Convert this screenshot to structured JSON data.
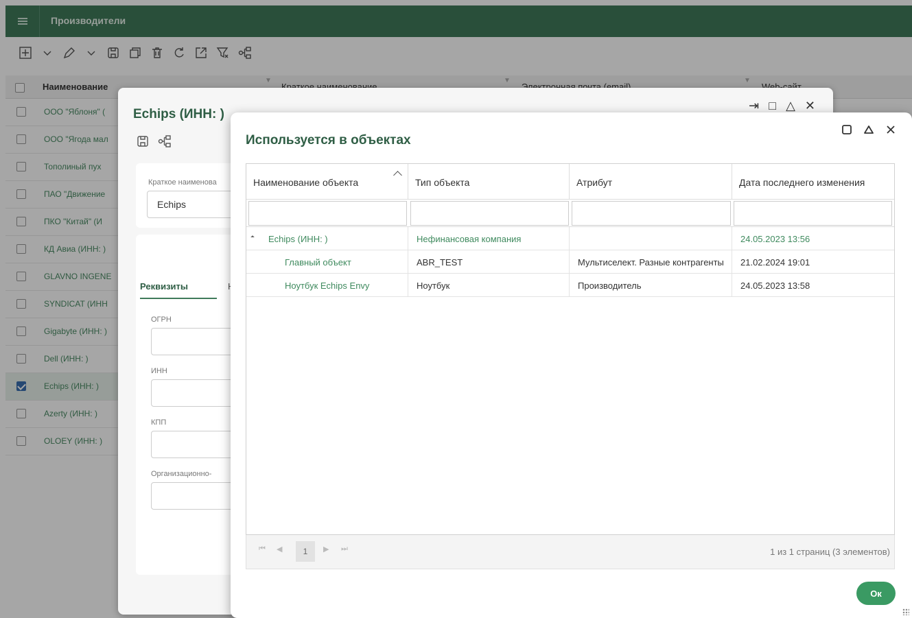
{
  "app": {
    "title": "Производители"
  },
  "grid": {
    "columns": [
      "Наименование",
      "Краткое наименование",
      "Электронная почта (email)",
      "Web-сайт"
    ],
    "rows": [
      {
        "name": "ООО \"Яблоня\" (",
        "checked": false
      },
      {
        "name": "ООО \"Ягода мал",
        "checked": false
      },
      {
        "name": "Тополиный пух",
        "checked": false
      },
      {
        "name": "ПАО \"Движение",
        "checked": false
      },
      {
        "name": "ПКО \"Китай\" (И",
        "checked": false
      },
      {
        "name": "КД Авиа (ИНН: )",
        "checked": false
      },
      {
        "name": "GLAVNO INGENE",
        "checked": false
      },
      {
        "name": "SYNDICAT (ИНН",
        "checked": false
      },
      {
        "name": "Gigabyte (ИНН: )",
        "checked": false
      },
      {
        "name": "Dell (ИНН: )",
        "checked": false
      },
      {
        "name": "Echips (ИНН: )",
        "checked": true
      },
      {
        "name": "Azerty (ИНН: )",
        "checked": false
      },
      {
        "name": "OLOEY (ИНН: )",
        "checked": false
      }
    ]
  },
  "producer_dialog": {
    "title": "Echips (ИНН: )",
    "short_name_label": "Краткое наименова",
    "short_name_value": "Echips",
    "tab_active": "Реквизиты",
    "tab_next": "Н",
    "ogrn_label": "ОГРН",
    "inn_label": "ИНН",
    "kpp_label": "КПП",
    "org_form_label": "Организационно-"
  },
  "usage_dialog": {
    "title": "Используется в объектах",
    "columns": [
      "Наименование объекта",
      "Тип объекта",
      "Атрибут",
      "Дата последнего изменения"
    ],
    "rows": [
      {
        "name": "Echips (ИНН: )",
        "type": "Нефинансовая компания",
        "attribute": "",
        "date": "24.05.2023 13:56"
      },
      {
        "name": "Главный объект",
        "type": "ABR_TEST",
        "attribute": "Мультиселект. Разные контрагенты",
        "date": "21.02.2024 19:01"
      },
      {
        "name": "Ноутбук Echips Envy",
        "type": "Ноутбук",
        "attribute": "Производитель",
        "date": "24.05.2023 13:58"
      }
    ],
    "pager": {
      "current_page": "1",
      "info": "1 из 1 страниц (3 элементов)"
    },
    "ok_label": "Ок"
  },
  "colors": {
    "header_green": "#3f7a5a",
    "link_green": "#3f8a5e",
    "ok_button": "#3a9a63"
  }
}
